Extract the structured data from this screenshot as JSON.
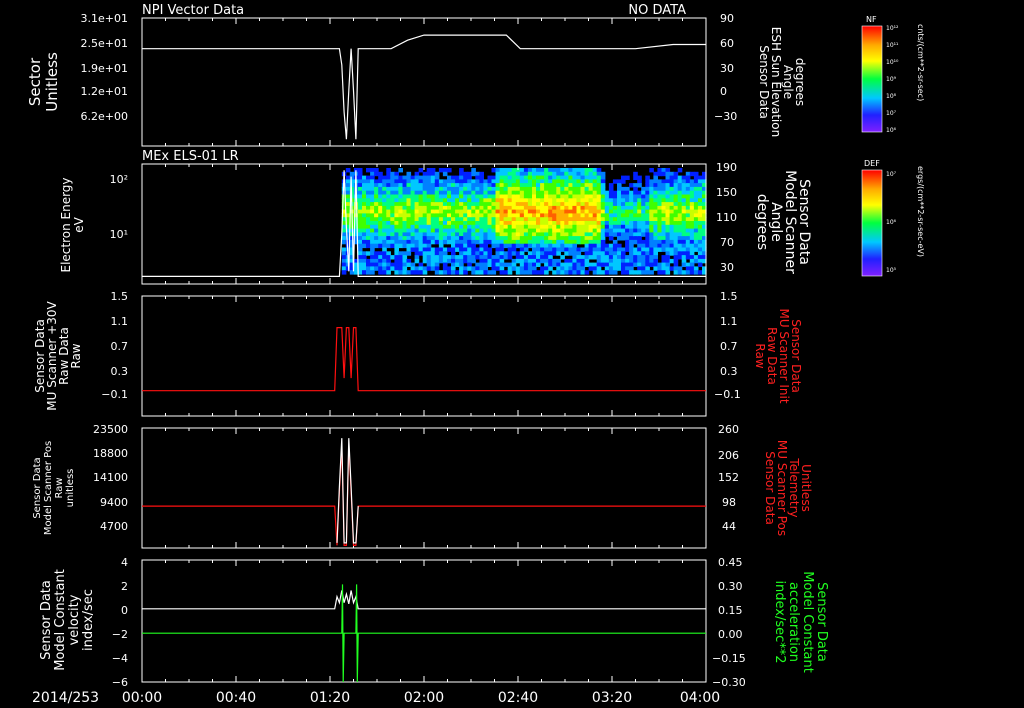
{
  "chart_data": [
    {
      "type": "line",
      "header_left": "NPI Vector Data",
      "header_right": "NO DATA",
      "left_axis": {
        "label": [
          "Sector",
          "Unitless"
        ],
        "ticks": [
          "3.1e+01",
          "2.5e+01",
          "1.9e+01",
          "1.2e+01",
          "6.2e+00"
        ]
      },
      "right_axis": {
        "label": [
          "Sensor Data",
          "ESH Sun Elevation",
          "Angle",
          "degrees"
        ],
        "ticks": [
          "90",
          "60",
          "30",
          "0",
          "−30"
        ],
        "ylim": [
          -60,
          90
        ],
        "color": "#ffffff"
      },
      "series": [
        {
          "axis": "right",
          "color": "#ffffff",
          "x": [
            0,
            84,
            85,
            86,
            87,
            88,
            89,
            90,
            91,
            92,
            106,
            113,
            120,
            155,
            161,
            210,
            226,
            240
          ],
          "y": [
            54,
            54,
            35,
            -20,
            -52,
            5,
            54,
            5,
            -52,
            54,
            54,
            64,
            70,
            70,
            54,
            54,
            59,
            59
          ]
        }
      ]
    },
    {
      "type": "heatmap",
      "header_left": "MEx ELS-01 LR",
      "left_axis": {
        "label": [
          "Electron Energy",
          "eV"
        ],
        "ticks": [
          "10²",
          "10¹"
        ],
        "scale": "log"
      },
      "right_axis": {
        "label": [
          "Sensor Data",
          "Model Scanner",
          "Angle",
          "degrees"
        ],
        "ticks": [
          "190",
          "150",
          "110",
          "70",
          "30"
        ],
        "ylim": [
          0,
          190
        ],
        "color": "#ffffff"
      },
      "colorbar": {
        "label": "DEF",
        "unit": "ergs/(cm**2-sr-sec-eV)",
        "ticks": [
          "10⁷",
          "10⁶",
          "10⁵"
        ]
      },
      "series": [
        {
          "axis": "right",
          "color": "#ffffff",
          "x": [
            0,
            84,
            85,
            86,
            87,
            88,
            89,
            90,
            91,
            92,
            93,
            240
          ],
          "y": [
            12,
            12,
            80,
            180,
            90,
            20,
            170,
            20,
            180,
            12,
            12,
            12
          ]
        }
      ]
    },
    {
      "type": "line",
      "left_axis": {
        "label": [
          "Sensor Data",
          "MU Scanner +30V",
          "Raw Data",
          "Raw"
        ],
        "ticks": [
          "1.5",
          "1.1",
          "0.7",
          "0.3",
          "−0.1"
        ],
        "ylim": [
          -0.4,
          1.5
        ]
      },
      "right_axis": {
        "label": [
          "Sensor Data",
          "MU Scanner Init",
          "Raw Data",
          "Raw"
        ],
        "ticks": [
          "1.5",
          "1.1",
          "0.7",
          "0.3",
          "−0.1"
        ],
        "ylim": [
          -0.4,
          1.5
        ],
        "color": "#ff2020"
      },
      "series": [
        {
          "axis": "left",
          "color": "#ff1010",
          "x": [
            0,
            82,
            83,
            84,
            85,
            86,
            87,
            88,
            89,
            90,
            91,
            92,
            93,
            240
          ],
          "y": [
            0,
            0,
            1,
            1,
            1,
            0.2,
            1,
            1,
            0.2,
            1,
            1,
            0,
            0,
            0
          ]
        }
      ]
    },
    {
      "type": "line",
      "left_axis": {
        "label": [
          "Sensor Data",
          "Model Scanner Pos",
          "Raw",
          "unitless"
        ],
        "ticks": [
          "23500",
          "18800",
          "14100",
          "9400",
          "4700"
        ],
        "ylim": [
          0,
          23500
        ]
      },
      "right_axis": {
        "label": [
          "Sensor Data",
          "MU Scanner Pos",
          "Telemetry",
          "Unitless"
        ],
        "ticks": [
          "260",
          "206",
          "152",
          "98",
          "44"
        ],
        "ylim": [
          0,
          260
        ],
        "color": "#ff2020"
      },
      "series": [
        {
          "axis": "left",
          "color": "#ff1010",
          "x": [
            0,
            82,
            83,
            84,
            85,
            86,
            87,
            88,
            89,
            90,
            91,
            92,
            93,
            240
          ],
          "y": [
            8200,
            8200,
            500,
            11000,
            20000,
            500,
            500,
            20000,
            11000,
            500,
            500,
            8200,
            8200,
            8200
          ]
        },
        {
          "axis": "left",
          "color": "#ffffff",
          "x": [
            83,
            84,
            85,
            86,
            87,
            88,
            89,
            90,
            91,
            92
          ],
          "y": [
            1000,
            12000,
            21500,
            1000,
            1000,
            21500,
            12000,
            1000,
            1000,
            8200
          ]
        }
      ]
    },
    {
      "type": "line",
      "left_axis": {
        "label": [
          "Sensor Data",
          "Model Constant",
          "velocity",
          "index/sec"
        ],
        "ticks": [
          "4",
          "2",
          "0",
          "−2",
          "−4",
          "−6"
        ],
        "ylim": [
          -6,
          4
        ]
      },
      "right_axis": {
        "label": [
          "Sensor Data",
          "Model Constant",
          "acceleration",
          "index/sec**2"
        ],
        "ticks": [
          "0.45",
          "0.30",
          "0.15",
          "0.00",
          "−0.15",
          "−0.30"
        ],
        "ylim": [
          -0.3,
          0.45
        ],
        "color": "#20ff20"
      },
      "series": [
        {
          "axis": "left",
          "color": "#ffffff",
          "x": [
            0,
            82,
            83,
            84,
            85,
            86,
            87,
            88,
            89,
            90,
            91,
            92,
            240
          ],
          "y": [
            0,
            0,
            1,
            0.5,
            1.5,
            0.5,
            1.2,
            0.4,
            1.5,
            0.5,
            1,
            0,
            0
          ]
        },
        {
          "axis": "left",
          "color": "#20ff20",
          "x": [
            0,
            85,
            85.3,
            85.6,
            86,
            91,
            91.3,
            91.6,
            92,
            240
          ],
          "y": [
            -2,
            -2,
            2,
            -6,
            -2,
            -2,
            2,
            -6,
            -2,
            -2
          ]
        }
      ]
    }
  ],
  "time_axis": {
    "date": "2014/253",
    "ticks": [
      "00:00",
      "00:40",
      "01:20",
      "02:00",
      "02:40",
      "03:20",
      "04:00"
    ],
    "xlim_minutes": [
      0,
      240
    ]
  },
  "top_colorbar": {
    "label": "NF",
    "unit": "cnts/(cm**2-sr-sec)",
    "ticks": [
      "10¹²",
      "10¹¹",
      "10¹⁰",
      "10⁹",
      "10⁸",
      "10⁷",
      "10⁶"
    ]
  }
}
